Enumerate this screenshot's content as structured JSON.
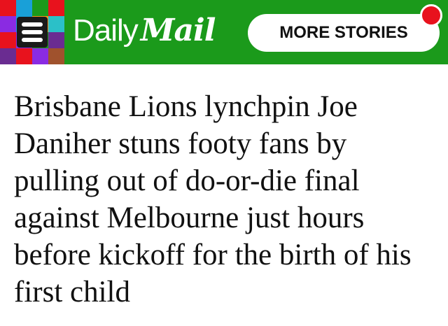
{
  "header": {
    "background_color": "#1b9a1b",
    "menu": {
      "icon": "hamburger-icon",
      "mosaic_colors": [
        "#e8121d",
        "#19a0d8",
        "#1b9a1b",
        "#e8121d",
        "#8a2be2",
        "#19a0d8",
        "#f7941d",
        "#2bc0c8",
        "#e8121d",
        "#8a2be2",
        "#1b9a1b",
        "#6a2c91",
        "#6a2c91",
        "#e8121d",
        "#8a2be2",
        "#a0522d"
      ]
    },
    "logo": {
      "part1": "Daily",
      "part2": "Mail"
    },
    "more_stories_label": "MORE STORIES",
    "notification_color": "#e8121d"
  },
  "article": {
    "headline": "Brisbane Lions lynchpin Joe Daniher stuns footy fans by pulling out of do-or-die final against Melbourne just hours before kickoff for the birth of his first child"
  }
}
